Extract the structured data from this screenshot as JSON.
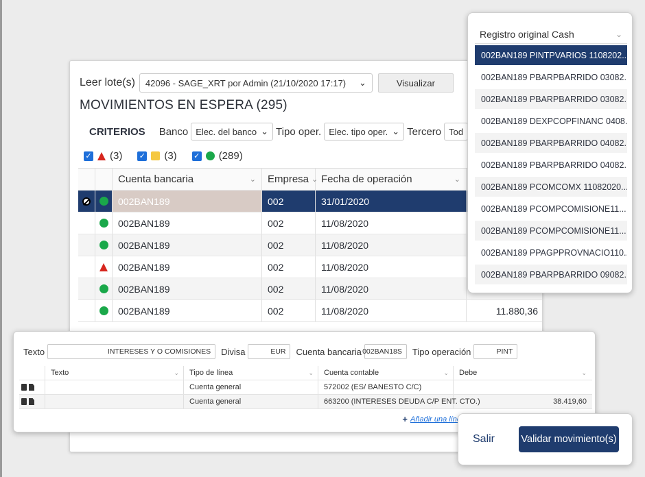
{
  "leer_lote": {
    "label": "Leer lote(s)",
    "selected": "42096 - SAGE_XRT por Admin (21/10/2020 17:17)",
    "visualizar": "Visualizar"
  },
  "title": "MOVIMIENTOS EN ESPERA (295)",
  "criterios": {
    "label": "CRITERIOS",
    "banco_label": "Banco",
    "banco_value": "Elec. del banco",
    "tipo_label": "Tipo oper.",
    "tipo_value": "Elec. tipo oper.",
    "tercero_label": "Tercero",
    "tercero_value": "Tod"
  },
  "legend": {
    "error_count": "(3)",
    "warning_count": "(3)",
    "ok_count": "(289)"
  },
  "grid": {
    "headers": [
      "Cuenta bancaria",
      "Empresa",
      "Fecha de operación"
    ],
    "rows": [
      {
        "cuenta": "002BAN189",
        "empresa": "002",
        "fecha": "31/01/2020",
        "importe": ""
      },
      {
        "cuenta": "002BAN189",
        "empresa": "002",
        "fecha": "11/08/2020",
        "importe": ""
      },
      {
        "cuenta": "002BAN189",
        "empresa": "002",
        "fecha": "11/08/2020",
        "importe": ""
      },
      {
        "cuenta": "002BAN189",
        "empresa": "002",
        "fecha": "11/08/2020",
        "importe": ""
      },
      {
        "cuenta": "002BAN189",
        "empresa": "002",
        "fecha": "11/08/2020",
        "importe": ""
      },
      {
        "cuenta": "002BAN189",
        "empresa": "002",
        "fecha": "11/08/2020",
        "importe": "11.880,36"
      }
    ]
  },
  "popup": {
    "header": "Registro original Cash",
    "items": [
      "002BAN189 PINTPVARIOS 1108202...",
      "002BAN189 PBARPBARRIDO 03082...",
      "002BAN189 PBARPBARRIDO 03082...",
      "002BAN189 DEXPCOPFINANC 0408...",
      "002BAN189 PBARPBARRIDO 04082...",
      "002BAN189 PBARPBARRIDO 04082...",
      "002BAN189 PCOMCOMX 11082020...",
      "002BAN189 PCOMPCOMISIONE11...",
      "002BAN189 PCOMPCOMISIONE11...",
      "002BAN189 PPAGPPROVNACIO110...",
      "002BAN189 PBARPBARRIDO 09082..."
    ]
  },
  "lower": {
    "texto_label": "Texto",
    "texto_value": "INTERESES Y O COMISIONES",
    "divisa_label": "Divisa",
    "divisa_value": "EUR",
    "cuenta_label": "Cuenta bancaria",
    "cuenta_value": "002BAN18S",
    "tipo_label": "Tipo operación",
    "tipo_value": "PINT",
    "headers": [
      "Texto",
      "Tipo de línea",
      "Cuenta contable",
      "Debe"
    ],
    "rows": [
      {
        "texto": "",
        "tipo": "Cuenta general",
        "cuenta": "572002 (ES/ BANESTO C/C)",
        "debe": ""
      },
      {
        "texto": "",
        "tipo": "Cuenta general",
        "cuenta": "663200 (INTERESES DEUDA C/P ENT. CTO.)",
        "debe": "38.419,60"
      }
    ],
    "add_line": "Añadir una líne"
  },
  "actions": {
    "salir": "Salir",
    "validar": "Validar movimiento(s)"
  },
  "colors": {
    "navy": "#1f3c6e",
    "ok": "#1aa84a",
    "error": "#d7261e",
    "warning": "#f5c842"
  }
}
